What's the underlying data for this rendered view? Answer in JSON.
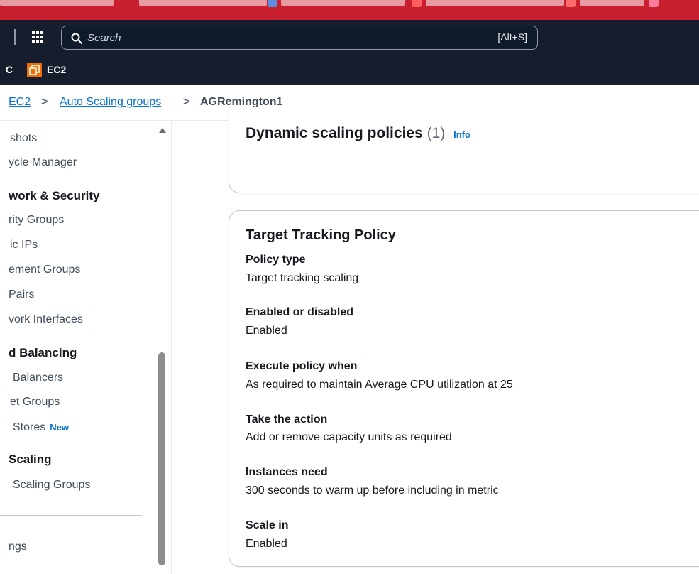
{
  "topbar": {
    "search": {
      "placeholder": "Search",
      "shortcut": "[Alt+S]"
    }
  },
  "service_bar": {
    "cut_prefix": "C",
    "service_label": "EC2"
  },
  "breadcrumb": {
    "items": [
      {
        "label": "EC2"
      },
      {
        "label": "Auto Scaling groups"
      },
      {
        "label": "AGRemington1"
      }
    ],
    "separator": ">"
  },
  "sidebar": {
    "items": [
      {
        "label": "shots"
      },
      {
        "label": "ycle Manager"
      },
      {
        "label": "work & Security",
        "heading": true
      },
      {
        "label": "rity Groups"
      },
      {
        "label": "ic IPs"
      },
      {
        "label": "ement Groups"
      },
      {
        "label": "Pairs"
      },
      {
        "label": "vork Interfaces"
      },
      {
        "label": "d Balancing",
        "heading": true
      },
      {
        "label": "Balancers"
      },
      {
        "label": "et Groups"
      },
      {
        "label": "Stores",
        "badge": "New"
      },
      {
        "label": "Scaling",
        "heading": true
      },
      {
        "label": "Scaling Groups"
      },
      {
        "label": "ngs"
      }
    ]
  },
  "dynamic_scaling": {
    "title": "Dynamic scaling policies",
    "count": "(1)",
    "info_label": "Info"
  },
  "policy": {
    "title": "Target Tracking Policy",
    "fields": [
      {
        "label": "Policy type",
        "value": "Target tracking scaling"
      },
      {
        "label": "Enabled or disabled",
        "value": "Enabled"
      },
      {
        "label": "Execute policy when",
        "value": "As required to maintain Average CPU utilization at 25"
      },
      {
        "label": "Take the action",
        "value": "Add or remove capacity units as required"
      },
      {
        "label": "Instances need",
        "value": "300 seconds to warm up before including in metric"
      },
      {
        "label": "Scale in",
        "value": "Enabled"
      }
    ]
  },
  "colors": {
    "browser_tabstrip": "#c8202f",
    "console_header": "#161e2d",
    "link": "#0972d3",
    "ec2_badge": "#ed7100"
  }
}
